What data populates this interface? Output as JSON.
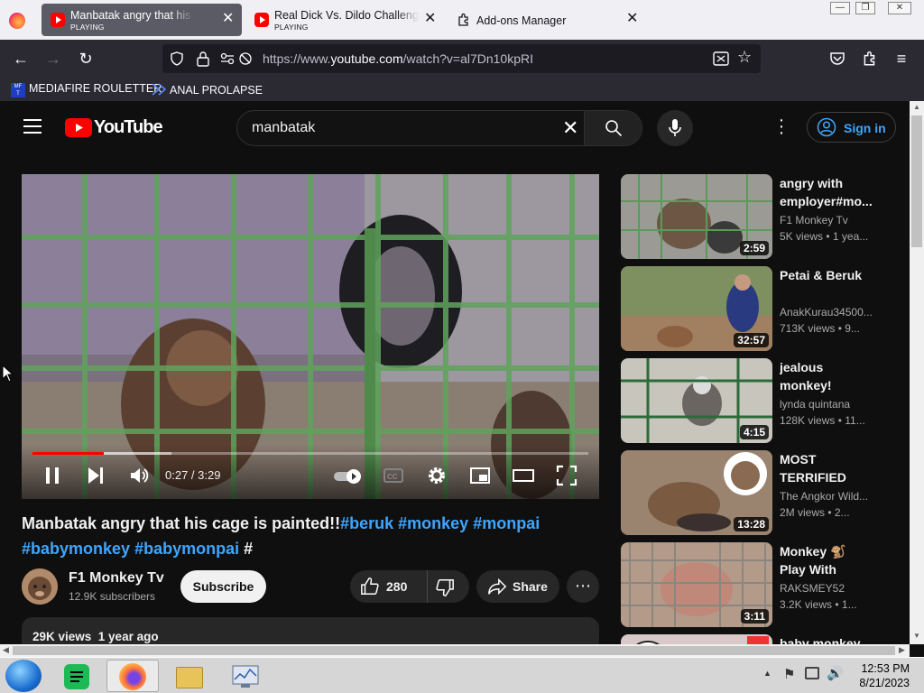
{
  "browser": {
    "tabs": [
      {
        "title": "Manbatak angry that his cage is painted!!",
        "status": "PLAYING",
        "active": true
      },
      {
        "title": "Real Dick Vs. Dildo Challenge",
        "status": "PLAYING",
        "active": false
      },
      {
        "title": "Add-ons Manager",
        "status": "",
        "active": false
      }
    ],
    "url_prefix": "https://www.",
    "url_domain": "youtube.com",
    "url_path": "/watch?v=al7Dn10kpRI",
    "bookmarks": [
      "MEDIAFIRE ROULETTER",
      "ANAL PROLAPSE"
    ]
  },
  "youtube": {
    "logo_text": "YouTube",
    "search_query": "manbatak",
    "signin_label": "Sign in",
    "player": {
      "current_time": "0:27 / 3:29",
      "progress": 0.129,
      "buffered": 0.25
    },
    "video": {
      "title": "Manbatak angry that his cage is painted!!",
      "hashtags": [
        "#beruk",
        "#monkey",
        "#monpai",
        "#babymonkey",
        "#babymonpai",
        "#"
      ],
      "channel": "F1 Monkey Tv",
      "subscribers": "12.9K subscribers",
      "subscribe_label": "Subscribe",
      "likes": "280",
      "share_label": "Share",
      "views_date": "29K views  1 year ago"
    },
    "recommendations": [
      {
        "title": "angry with employer#mo...",
        "channel": "F1 Monkey Tv",
        "meta": "5K views  • 1 yea...",
        "duration": "2:59"
      },
      {
        "title": "Petai & Beruk",
        "channel": "AnakKurau34500...",
        "meta": "713K views  • 9...",
        "duration": "32:57"
      },
      {
        "title": "jealous monkey!",
        "channel": "lynda quintana",
        "meta": "128K views  • 11...",
        "duration": "4:15"
      },
      {
        "title": "MOST TERRIFIED AN...",
        "channel": "The Angkor Wild...",
        "meta": "2M views  • 2...",
        "duration": "13:28"
      },
      {
        "title": "Monkey 🐒 Play With Man...",
        "channel": "RAKSMEY52",
        "meta": "3.2K views  • 1...",
        "duration": "3:11"
      },
      {
        "title": "baby monkey...",
        "channel": "",
        "meta": "",
        "duration": ""
      }
    ]
  },
  "taskbar": {
    "time": "12:53 PM",
    "date": "8/21/2023"
  },
  "colors": {
    "youtube_red": "#ff0000",
    "link_blue": "#3ea6ff",
    "background": "#0f0f0f"
  }
}
